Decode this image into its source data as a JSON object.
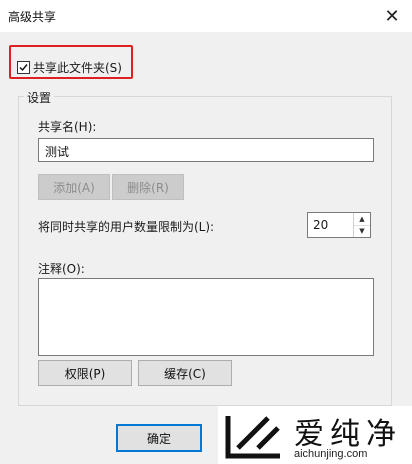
{
  "window": {
    "title": "高级共享",
    "close_glyph": "✕"
  },
  "share_checkbox": {
    "label": "共享此文件夹(S)",
    "checked": true
  },
  "settings": {
    "group_title": "设置",
    "share_name_label": "共享名(H):",
    "share_name_value": "测试",
    "add_button": "添加(A)",
    "remove_button": "删除(R)",
    "user_limit_label": "将同时共享的用户数量限制为(L):",
    "user_limit_value": "20",
    "comment_label": "注释(O):",
    "comment_value": "",
    "permissions_button": "权限(P)",
    "caching_button": "缓存(C)"
  },
  "footer": {
    "ok_button": "确定"
  },
  "watermark": {
    "brand": "爱纯净",
    "url": "aichunjing.com"
  },
  "colors": {
    "highlight": "#e02020",
    "default_button_border": "#0078d7"
  },
  "icons": {
    "close": "close-icon",
    "check": "checkmark-icon",
    "spin_up": "chevron-up-icon",
    "spin_down": "chevron-down-icon"
  }
}
